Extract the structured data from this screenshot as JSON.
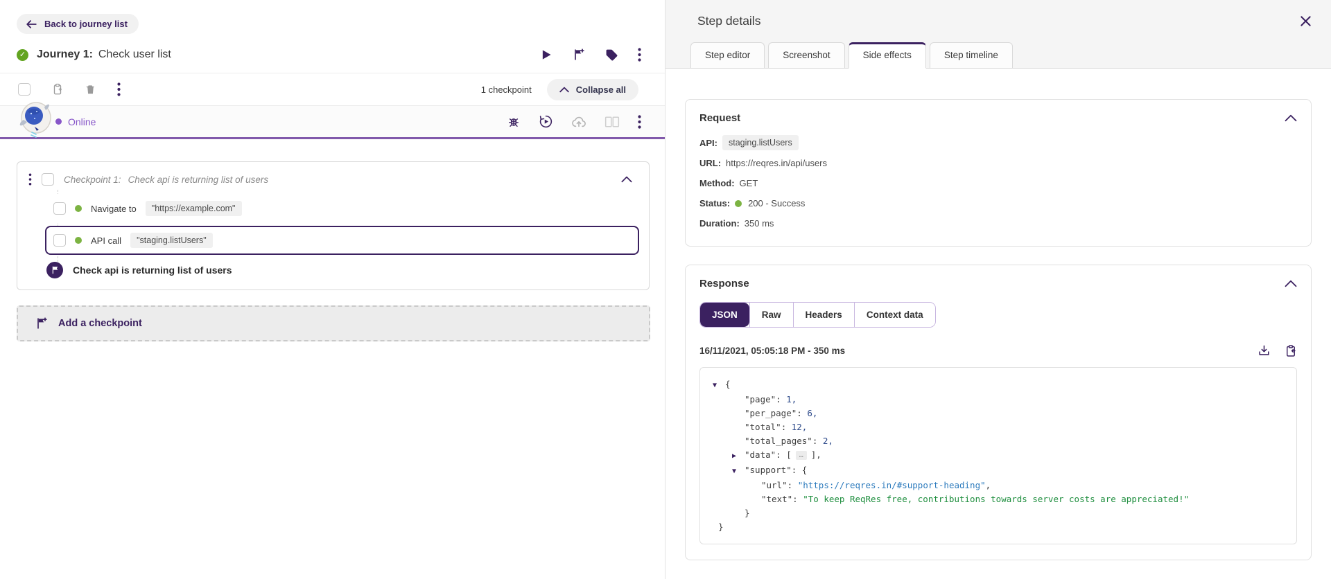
{
  "colors": {
    "accent": "#3b2160",
    "online_purple": "#8857c9",
    "success_green": "#7cb342",
    "json_number": "#2d4a8a",
    "json_string_url": "#2d7bbd",
    "json_string_text": "#1e8e3e"
  },
  "icons": {
    "arrow_down": "▼",
    "arrow_right": "▶",
    "ellipsis": "…",
    "check": "✓"
  },
  "left": {
    "back_button_label": "Back to journey list",
    "journey_label": "Journey 1:",
    "journey_title": "Check user list",
    "selection_toolbar": {
      "checkpoint_count": "1 checkpoint",
      "collapse_all_label": "Collapse all"
    },
    "status_label": "Online",
    "checkpoint": {
      "label": "Checkpoint 1:",
      "title": "Check api is returning list of users",
      "steps": [
        {
          "action": "Navigate to",
          "value": "\"https://example.com\""
        },
        {
          "action": "API call",
          "value": "\"staging.listUsers\""
        }
      ],
      "assertion_label": "Check api is returning list of users"
    },
    "add_checkpoint_label": "Add a checkpoint"
  },
  "panel": {
    "title": "Step details",
    "tabs": [
      {
        "label": "Step editor"
      },
      {
        "label": "Screenshot"
      },
      {
        "label": "Side effects"
      },
      {
        "label": "Step timeline"
      }
    ],
    "request": {
      "title": "Request",
      "api_label": "API:",
      "api_value": "staging.listUsers",
      "url_label": "URL:",
      "url_value": "https://reqres.in/api/users",
      "method_label": "Method:",
      "method_value": "GET",
      "status_label": "Status:",
      "status_value": "200 - Success",
      "duration_label": "Duration:",
      "duration_value": "350 ms"
    },
    "response": {
      "title": "Response",
      "tabs": [
        {
          "label": "JSON"
        },
        {
          "label": "Raw"
        },
        {
          "label": "Headers"
        },
        {
          "label": "Context data"
        }
      ],
      "timestamp": "16/11/2021, 05:05:18 PM - 350 ms",
      "json": {
        "open_brace": "{",
        "colon": ": ",
        "comma": ",",
        "page_key": "\"page\"",
        "page_val": "1,",
        "per_page_key": "\"per_page\"",
        "per_page_val": "6,",
        "total_key": "\"total\"",
        "total_val": "12,",
        "total_pages_key": "\"total_pages\"",
        "total_pages_val": "2,",
        "data_key": "\"data\"",
        "data_open": ": [",
        "data_close": "],",
        "support_key": "\"support\"",
        "support_open": ": {",
        "url_key": "\"url\"",
        "url_val": "\"https://reqres.in/#support-heading\"",
        "text_key": "\"text\"",
        "text_val": "\"To keep ReqRes free, contributions towards server costs are appreciated!\"",
        "close_brace": "}"
      }
    }
  }
}
